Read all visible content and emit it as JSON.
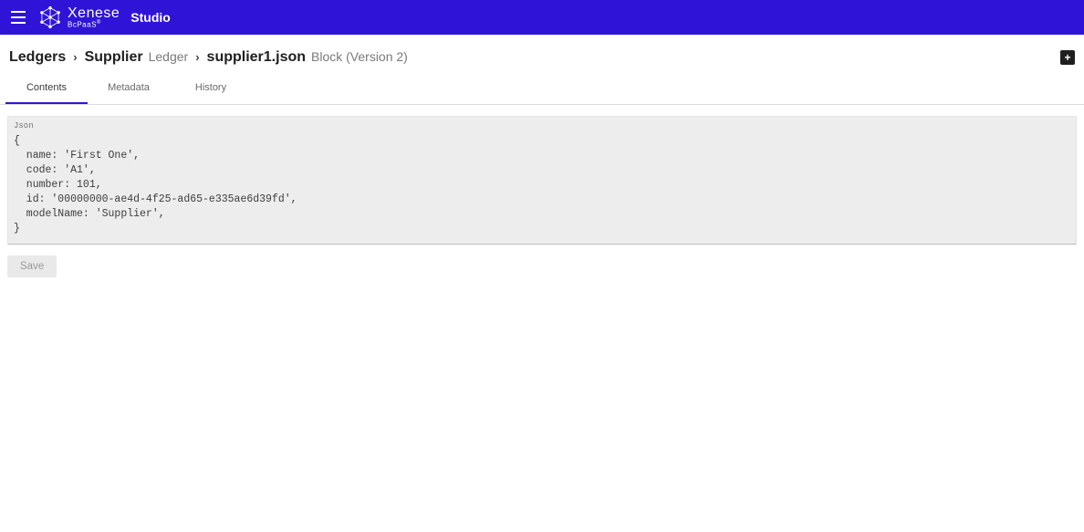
{
  "brand": {
    "name": "Xenese",
    "subtitle": "BcPaaS",
    "suffix": "Studio"
  },
  "breadcrumb": {
    "ledgers": "Ledgers",
    "supplier": "Supplier",
    "ledger_label": "Ledger",
    "file": "supplier1.json",
    "block_label": "Block (Version 2)"
  },
  "tabs": {
    "contents": "Contents",
    "metadata": "Metadata",
    "history": "History"
  },
  "code": {
    "label": "Json",
    "body": "{\n  name: 'First One',\n  code: 'A1',\n  number: 101,\n  id: '00000000-ae4d-4f25-ad65-e335ae6d39fd',\n  modelName: 'Supplier',\n}"
  },
  "buttons": {
    "save": "Save",
    "plus": "+"
  }
}
